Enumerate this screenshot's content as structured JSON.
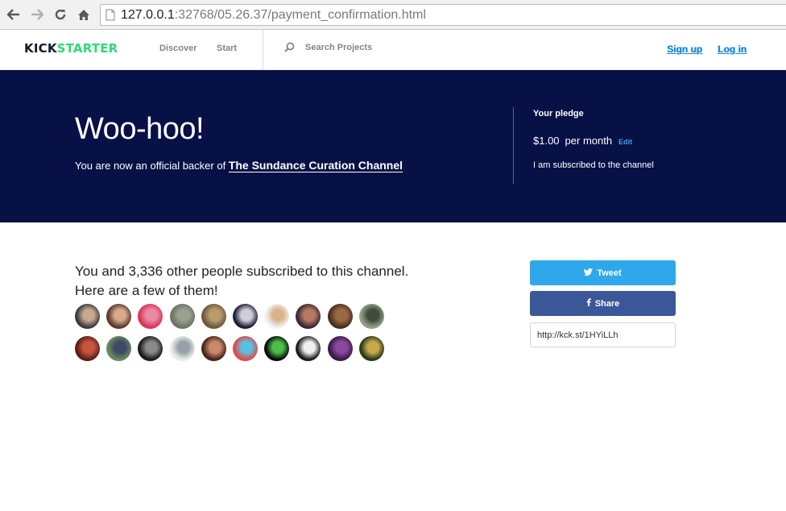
{
  "browser": {
    "url_host": "127.0.0.1",
    "url_rest": ":32768/05.26.37/payment_confirmation.html"
  },
  "header": {
    "logo_kick": "KICK",
    "logo_starter": "STARTER",
    "nav": [
      "Discover",
      "Start"
    ],
    "search_placeholder": "Search Projects",
    "signup": "Sign up",
    "login": "Log in"
  },
  "hero": {
    "title": "Woo-hoo!",
    "subtitle_prefix": "You are now an official backer of ",
    "project_name": "The Sundance Curation Channel",
    "pledge_label": "Your pledge",
    "pledge_amount": "$1.00",
    "pledge_period": "per month",
    "pledge_edit": "Edit",
    "pledge_status": "I am subscribed to the channel"
  },
  "main": {
    "backers_line1": "You and 3,336 other people subscribed to this channel.",
    "backers_line2": "Here are a few of them!",
    "tweet_label": "Tweet",
    "share_label": "Share",
    "short_link": "http://kck.st/1HYiLLh"
  },
  "colors": {
    "hero_bg": "#081145",
    "brand_green": "#2bde73",
    "link_blue": "#1a89e8",
    "tweet_blue": "#2ea8ea",
    "facebook_blue": "#3a5797"
  },
  "avatars": [
    {
      "c1": "#3b3b45",
      "c2": "#c9a88e"
    },
    {
      "c1": "#5b3b2c",
      "c2": "#d8a98a"
    },
    {
      "c1": "#d9365b",
      "c2": "#e88aa0"
    },
    {
      "c1": "#6b7466",
      "c2": "#9aa28f"
    },
    {
      "c1": "#6e5a3b",
      "c2": "#b89c6e"
    },
    {
      "c1": "#1d1f3a",
      "c2": "#cfcfd8"
    },
    {
      "c1": "#f2f2f2",
      "c2": "#d9b48a"
    },
    {
      "c1": "#3a2a33",
      "c2": "#b77a64"
    },
    {
      "c1": "#4a2f1c",
      "c2": "#9a6a44"
    },
    {
      "c1": "#8fa28a",
      "c2": "#3f4b3a"
    },
    {
      "c1": "#5a1e18",
      "c2": "#c9553d"
    },
    {
      "c1": "#6a8a5a",
      "c2": "#3c4a66"
    },
    {
      "c1": "#1a1a1a",
      "c2": "#8a8a8a"
    },
    {
      "c1": "#e8ece8",
      "c2": "#9aa0a8"
    },
    {
      "c1": "#4a241c",
      "c2": "#c98a6a"
    },
    {
      "c1": "#e04a4a",
      "c2": "#5ac0e0"
    },
    {
      "c1": "#0a0a0a",
      "c2": "#4ac04a"
    },
    {
      "c1": "#1a1a1a",
      "c2": "#f0f0f0"
    },
    {
      "c1": "#3a1a4a",
      "c2": "#8a4a9a"
    },
    {
      "c1": "#2a3a1a",
      "c2": "#c8a84a"
    }
  ]
}
